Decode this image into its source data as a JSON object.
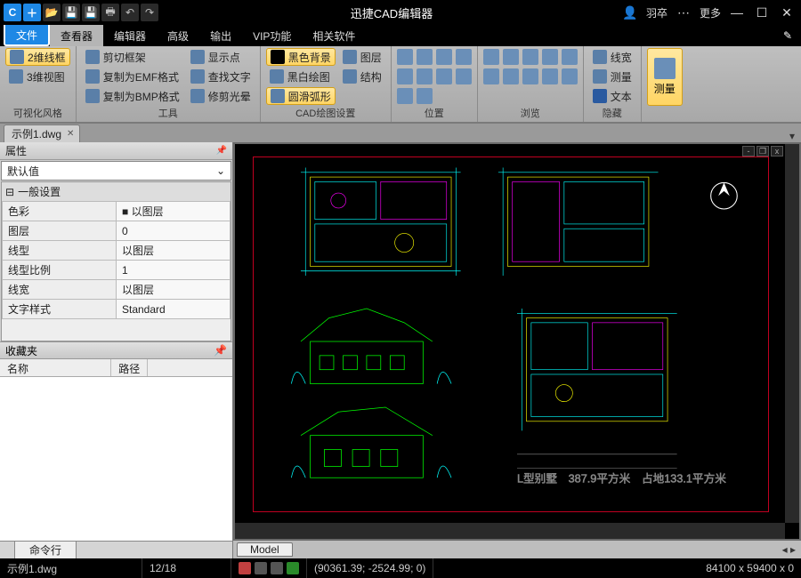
{
  "app": {
    "title": "迅捷CAD编辑器",
    "user": "羽卒",
    "more": "更多"
  },
  "menu": {
    "file": "文件",
    "viewer": "查看器",
    "editor": "编辑器",
    "advanced": "高级",
    "output": "输出",
    "vip": "VIP功能",
    "related": "相关软件"
  },
  "ribbon": {
    "g1": {
      "label": "可视化风格",
      "b1": "2维线框",
      "b2": "3维视图"
    },
    "g2": {
      "label": "工具",
      "b1": "剪切框架",
      "b2": "复制为EMF格式",
      "b3": "复制为BMP格式",
      "b4": "显示点",
      "b5": "查找文字",
      "b6": "修剪光晕"
    },
    "g3": {
      "label": "CAD绘图设置",
      "b1": "黑色背景",
      "b2": "黑白绘图",
      "b3": "圆滑弧形",
      "b4": "图层",
      "b5": "结构"
    },
    "g4": {
      "label": "位置"
    },
    "g5": {
      "label": "浏览"
    },
    "g6": {
      "label": "隐藏",
      "b1": "线宽",
      "b2": "测量",
      "b3": "文本"
    },
    "g7": {
      "label": "测量"
    }
  },
  "doc": {
    "tab": "示例1.dwg"
  },
  "panels": {
    "props": "属性",
    "default": "默认值",
    "general": "一般设置",
    "rows": [
      {
        "k": "色彩",
        "v": "■ 以图层"
      },
      {
        "k": "图层",
        "v": "0"
      },
      {
        "k": "线型",
        "v": "以图层"
      },
      {
        "k": "线型比例",
        "v": "1"
      },
      {
        "k": "线宽",
        "v": "以图层"
      },
      {
        "k": "文字样式",
        "v": "Standard"
      }
    ],
    "fav": "收藏夹",
    "col1": "名称",
    "col2": "路径",
    "cmd": "命令行"
  },
  "model": "Model",
  "status": {
    "file": "示例1.dwg",
    "pages": "12/18",
    "coords": "(90361.39; -2524.99; 0)",
    "dims": "84100 x 59400 x 0"
  }
}
